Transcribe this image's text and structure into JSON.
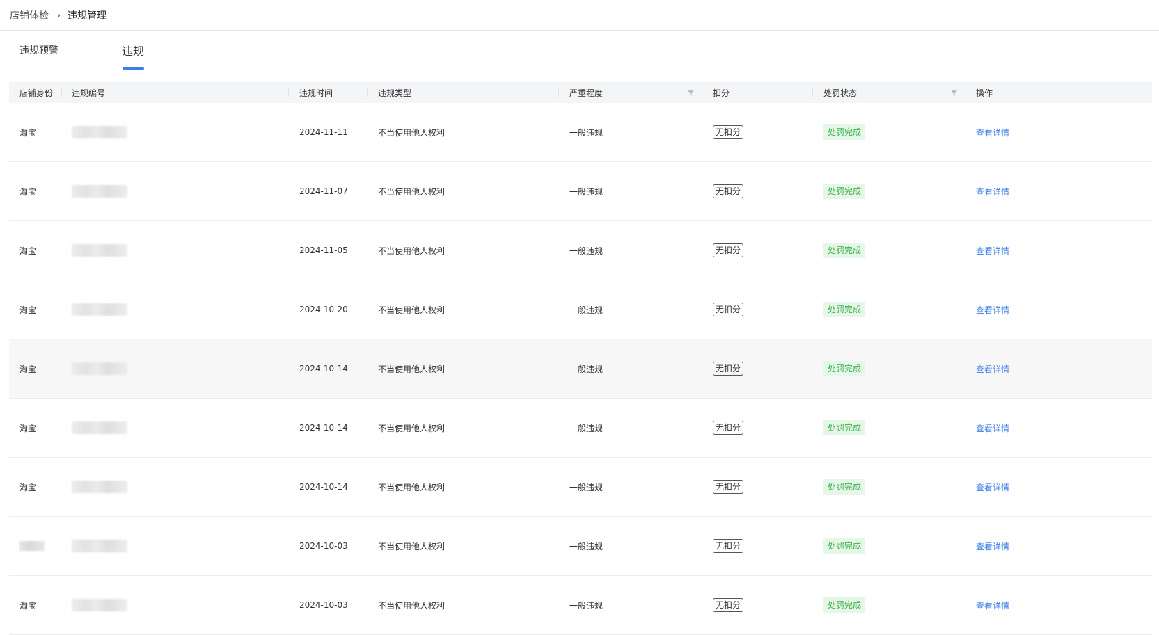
{
  "breadcrumb": {
    "parent": "店铺体检",
    "separator": "›",
    "current": "违规管理"
  },
  "tabs": [
    {
      "label": "违规预警",
      "active": false
    },
    {
      "label": "违规",
      "active": true
    }
  ],
  "table": {
    "columns": {
      "identity": "店铺身份",
      "id": "违规编号",
      "time": "违规时间",
      "type": "违规类型",
      "severity": "严重程度",
      "score": "扣分",
      "status": "处罚状态",
      "action": "操作"
    },
    "rows": [
      {
        "identity": "淘宝",
        "id_blurred": true,
        "time": "2024-11-11",
        "type": "不当使用他人权利",
        "severity": "一般违规",
        "score": "无扣分",
        "status": "处罚完成",
        "action": "查看详情"
      },
      {
        "identity": "淘宝",
        "id_blurred": true,
        "time": "2024-11-07",
        "type": "不当使用他人权利",
        "severity": "一般违规",
        "score": "无扣分",
        "status": "处罚完成",
        "action": "查看详情"
      },
      {
        "identity": "淘宝",
        "id_blurred": true,
        "time": "2024-11-05",
        "type": "不当使用他人权利",
        "severity": "一般违规",
        "score": "无扣分",
        "status": "处罚完成",
        "action": "查看详情"
      },
      {
        "identity": "淘宝",
        "id_blurred": true,
        "time": "2024-10-20",
        "type": "不当使用他人权利",
        "severity": "一般违规",
        "score": "无扣分",
        "status": "处罚完成",
        "action": "查看详情"
      },
      {
        "identity": "淘宝",
        "id_blurred": true,
        "time": "2024-10-14",
        "type": "不当使用他人权利",
        "severity": "一般违规",
        "score": "无扣分",
        "status": "处罚完成",
        "action": "查看详情",
        "hovered": true
      },
      {
        "identity": "淘宝",
        "id_blurred": true,
        "time": "2024-10-14",
        "type": "不当使用他人权利",
        "severity": "一般违规",
        "score": "无扣分",
        "status": "处罚完成",
        "action": "查看详情"
      },
      {
        "identity": "淘宝",
        "id_blurred": true,
        "time": "2024-10-14",
        "type": "不当使用他人权利",
        "severity": "一般违规",
        "score": "无扣分",
        "status": "处罚完成",
        "action": "查看详情"
      },
      {
        "identity": "",
        "identity_blurred": true,
        "id_blurred": true,
        "time": "2024-10-03",
        "type": "不当使用他人权利",
        "severity": "一般违规",
        "score": "无扣分",
        "status": "处罚完成",
        "action": "查看详情"
      },
      {
        "identity": "淘宝",
        "id_blurred": true,
        "time": "2024-10-03",
        "type": "不当使用他人权利",
        "severity": "一般违规",
        "score": "无扣分",
        "status": "处罚完成",
        "action": "查看详情"
      }
    ]
  },
  "icons": {
    "filter": "filter-icon",
    "chevron": "chevron-right-icon"
  },
  "colors": {
    "accent": "#3d7fe6",
    "status_text": "#3cb24a",
    "status_bg": "#e6f6e8",
    "header_bg": "#f4f5f7"
  }
}
